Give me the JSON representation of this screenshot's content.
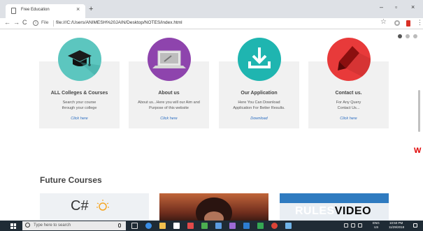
{
  "browser": {
    "tab_title": "Free Education",
    "tab_close": "×",
    "new_tab": "+",
    "address_label": "File",
    "address_url": "file:///C:/Users/ANIMESH%20JAIN/Desktop/NOTES/index.html",
    "window_controls": {
      "minimize": "–",
      "maximize": "▫",
      "close": "×"
    },
    "icons": [
      "back-arrow-icon",
      "forward-arrow-icon",
      "reload-icon",
      "info-icon",
      "star-icon",
      "extension-icon",
      "profile-icon",
      "menu-icon"
    ]
  },
  "page": {
    "side_letter": "W",
    "carousel_dots": 3,
    "cards": [
      {
        "icon": "graduation-cap-icon",
        "icon_color": "#5cc6bf",
        "title": "ALL Colleges & Courses",
        "desc": "Search your course\nthrough your college",
        "link": "Click here"
      },
      {
        "icon": "laptop-icon",
        "icon_color": "#8e44ad",
        "title": "About us",
        "desc": "About us...Here you will our Aim and\nPurpose of this website",
        "link": "Click here"
      },
      {
        "icon": "download-icon",
        "icon_color": "#1fb5b0",
        "title": "Our Application",
        "desc": "Here You Can Download\nApplication For Better Results.",
        "link": "Download"
      },
      {
        "icon": "pen-icon",
        "icon_color": "#e83a3a",
        "title": "Contact us.",
        "desc": "For Any Query\nContact Us...",
        "link": "Click here"
      }
    ],
    "section_title": "Future Courses",
    "thumbnails": {
      "csharp_text": "C#",
      "rules_text": "RULES",
      "video_text": "VIDEO"
    }
  },
  "taskbar": {
    "search_placeholder": "Type here to search",
    "language": "ENG",
    "region": "US",
    "time": "10:50 PM",
    "date": "11/29/2018"
  }
}
